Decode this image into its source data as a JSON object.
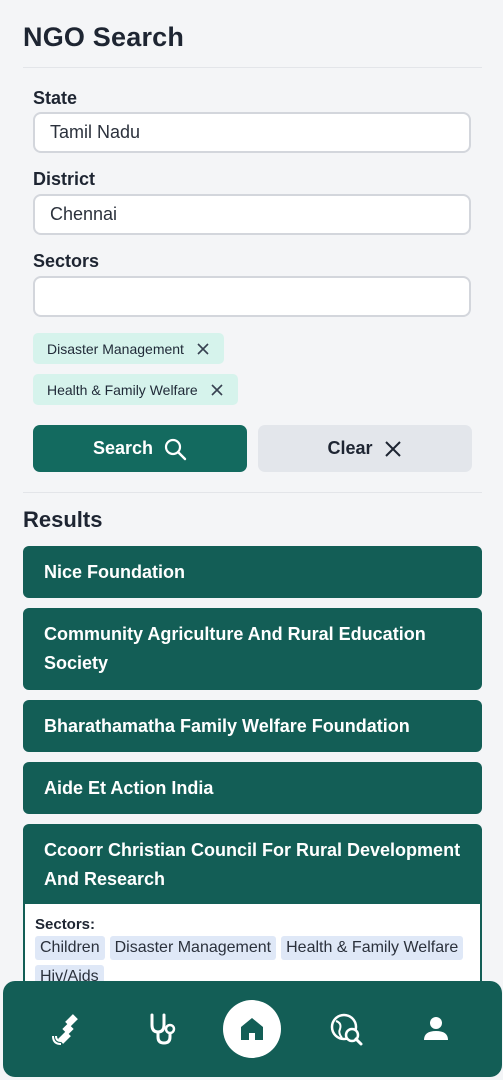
{
  "page": {
    "title": "NGO Search"
  },
  "form": {
    "state_label": "State",
    "state_value": "Tamil Nadu",
    "district_label": "District",
    "district_value": "Chennai",
    "sectors_label": "Sectors",
    "sectors_value": "",
    "selected_sectors": [
      "Disaster Management",
      "Health & Family Welfare"
    ],
    "search_label": "Search",
    "clear_label": "Clear"
  },
  "results": {
    "title": "Results",
    "items": [
      {
        "name": "Nice Foundation"
      },
      {
        "name": "Community Agriculture And Rural Education Society"
      },
      {
        "name": "Bharathamatha Family Welfare Foundation"
      },
      {
        "name": "Aide Et Action India"
      },
      {
        "name": "Ccoorr Christian Council For Rural Development And Research",
        "sectors_label": "Sectors:",
        "sectors": [
          "Children",
          "Disaster Management",
          "Health & Family Welfare",
          "Hiv/Aids"
        ]
      }
    ]
  },
  "nav": {
    "items": [
      "satellite-icon",
      "stethoscope-icon",
      "home-icon",
      "globe-search-icon",
      "user-icon"
    ],
    "active": "home-icon"
  },
  "colors": {
    "primary": "#135e56",
    "chip_bg": "#d6f3ec",
    "tag_bg": "#dfe8f7"
  }
}
